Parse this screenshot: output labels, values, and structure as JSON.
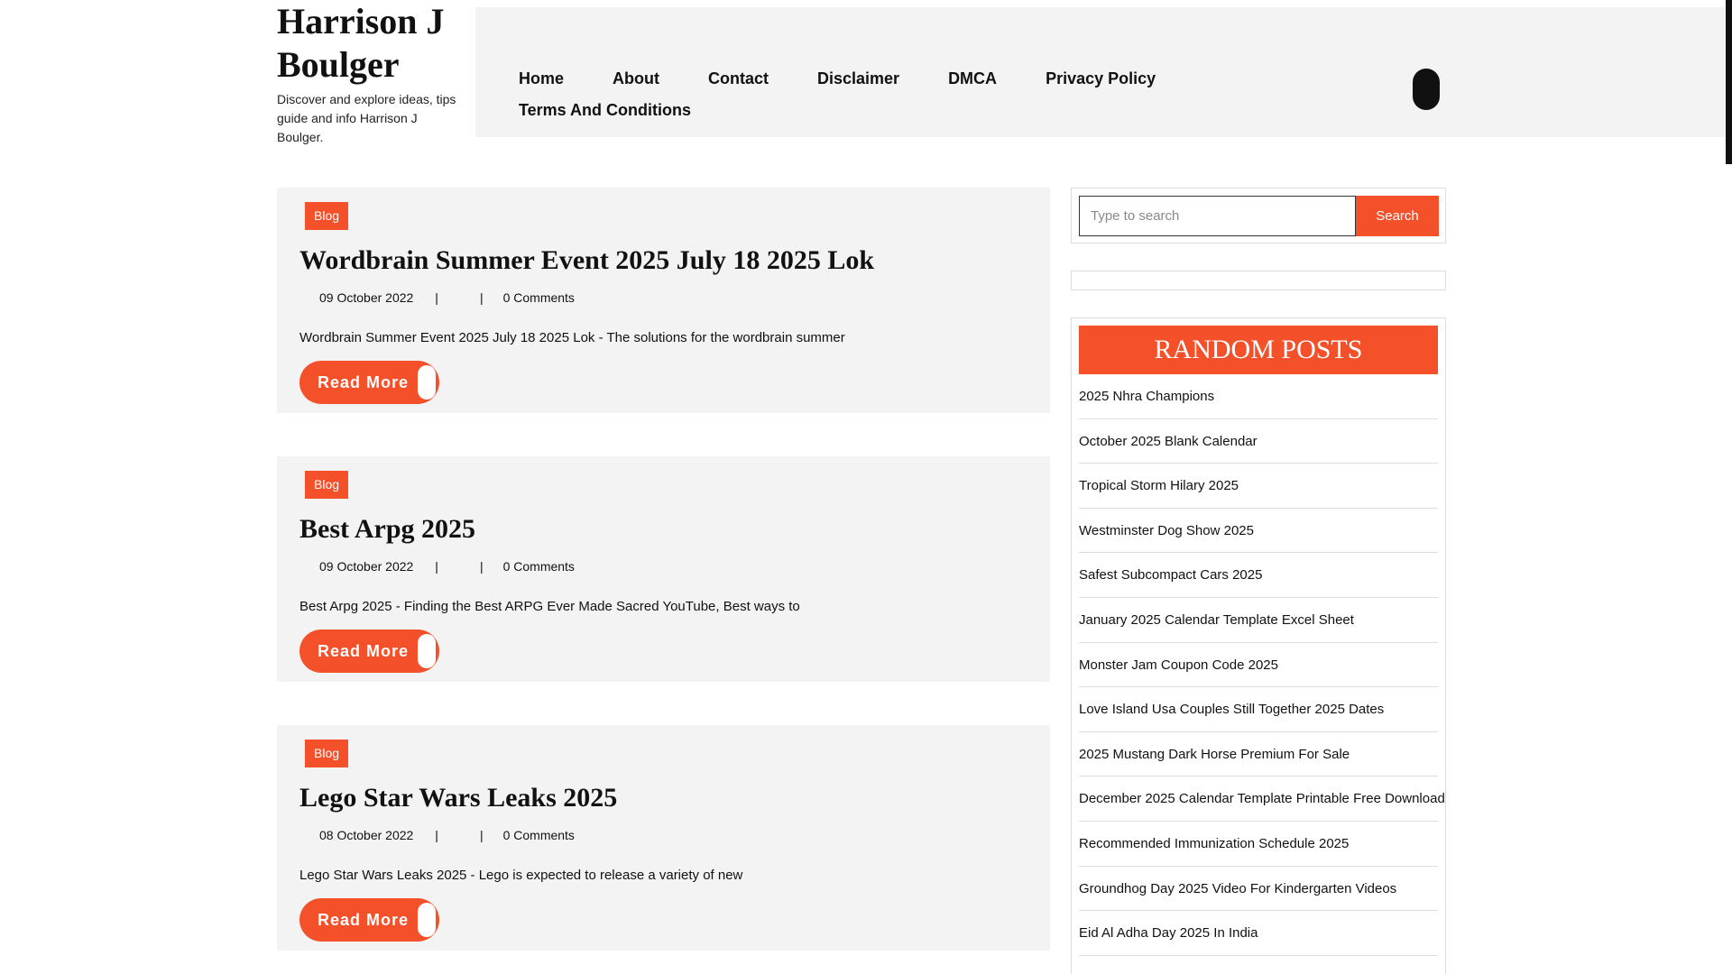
{
  "site": {
    "title": "Harrison J Boulger",
    "tagline": "Discover and explore ideas, tips guide and info Harrison J Boulger."
  },
  "nav": {
    "items": [
      "Home",
      "About",
      "Contact",
      "Disclaimer",
      "DMCA",
      "Privacy Policy",
      "Terms And Conditions"
    ]
  },
  "posts": [
    {
      "category": "Blog",
      "title": "Wordbrain Summer Event 2025 July 18 2025 Lok",
      "date": "09 October 2022",
      "separator": "|",
      "comments": "0 Comments",
      "excerpt": "Wordbrain Summer Event 2025 July 18 2025 Lok - The solutions for the wordbrain summer",
      "read_more": "Read More"
    },
    {
      "category": "Blog",
      "title": "Best Arpg 2025",
      "date": "09 October 2022",
      "separator": "|",
      "comments": "0 Comments",
      "excerpt": "Best Arpg 2025 - Finding the Best ARPG Ever Made Sacred YouTube, Best ways to",
      "read_more": "Read More"
    },
    {
      "category": "Blog",
      "title": "Lego Star Wars Leaks 2025",
      "date": "08 October 2022",
      "separator": "|",
      "comments": "0 Comments",
      "excerpt": "Lego Star Wars Leaks 2025 - Lego is expected to release a variety of new",
      "read_more": "Read More"
    }
  ],
  "search": {
    "placeholder": "Type to search",
    "button": "Search"
  },
  "random_posts": {
    "title": "RANDOM POSTS",
    "items": [
      "2025 Nhra Champions",
      "October 2025 Blank Calendar",
      "Tropical Storm Hilary 2025",
      "Westminster Dog Show 2025",
      "Safest Subcompact Cars 2025",
      "January 2025 Calendar Template Excel Sheet",
      "Monster Jam Coupon Code 2025",
      "Love Island Usa Couples Still Together 2025 Dates",
      "2025 Mustang Dark Horse Premium For Sale",
      "December 2025 Calendar Template Printable Free Download",
      "Recommended Immunization Schedule 2025",
      "Groundhog Day 2025 Video For Kindergarten Videos",
      "Eid Al Adha Day 2025 In India"
    ]
  },
  "colors": {
    "accent": "#f4502a",
    "panel": "#f3f3f3"
  }
}
